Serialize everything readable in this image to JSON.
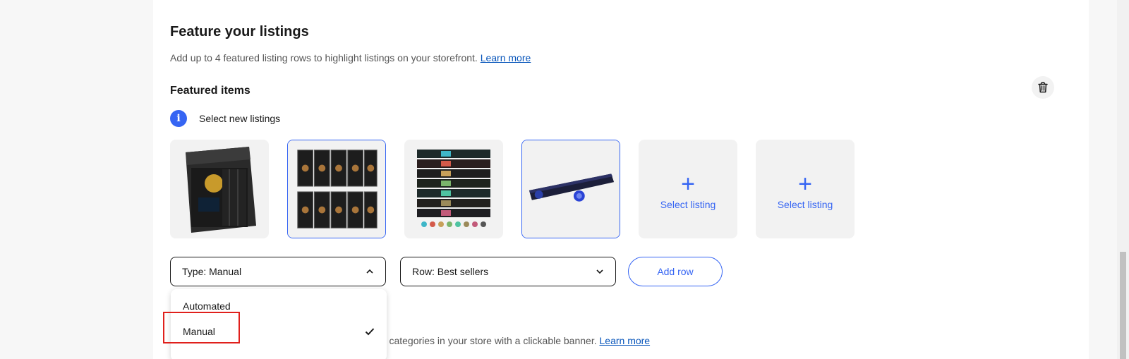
{
  "feature": {
    "title": "Feature your listings",
    "subtitle": "Add up to 4 featured listing rows to highlight listings on your storefront.",
    "learn_more": "Learn more"
  },
  "featured_items": {
    "title": "Featured items",
    "info_text": "Select new listings",
    "tiles": [
      {
        "type": "listing",
        "selected": false
      },
      {
        "type": "listing",
        "selected": true
      },
      {
        "type": "listing",
        "selected": false
      },
      {
        "type": "listing",
        "selected": true
      },
      {
        "type": "add",
        "label": "Select listing"
      },
      {
        "type": "add",
        "label": "Select listing"
      }
    ]
  },
  "controls": {
    "type_select": "Type: Manual",
    "row_select": "Row: Best sellers",
    "add_row": "Add row"
  },
  "dropdown": {
    "options": [
      {
        "label": "Automated",
        "checked": false
      },
      {
        "label": "Manual",
        "checked": true
      }
    ]
  },
  "banner": {
    "text": "Drive customers to promotions, featured items, or categories in your store with a clickable banner.",
    "learn_more": "Learn more"
  },
  "colors": {
    "accent": "#3665f3",
    "highlight": "#e0201c"
  }
}
